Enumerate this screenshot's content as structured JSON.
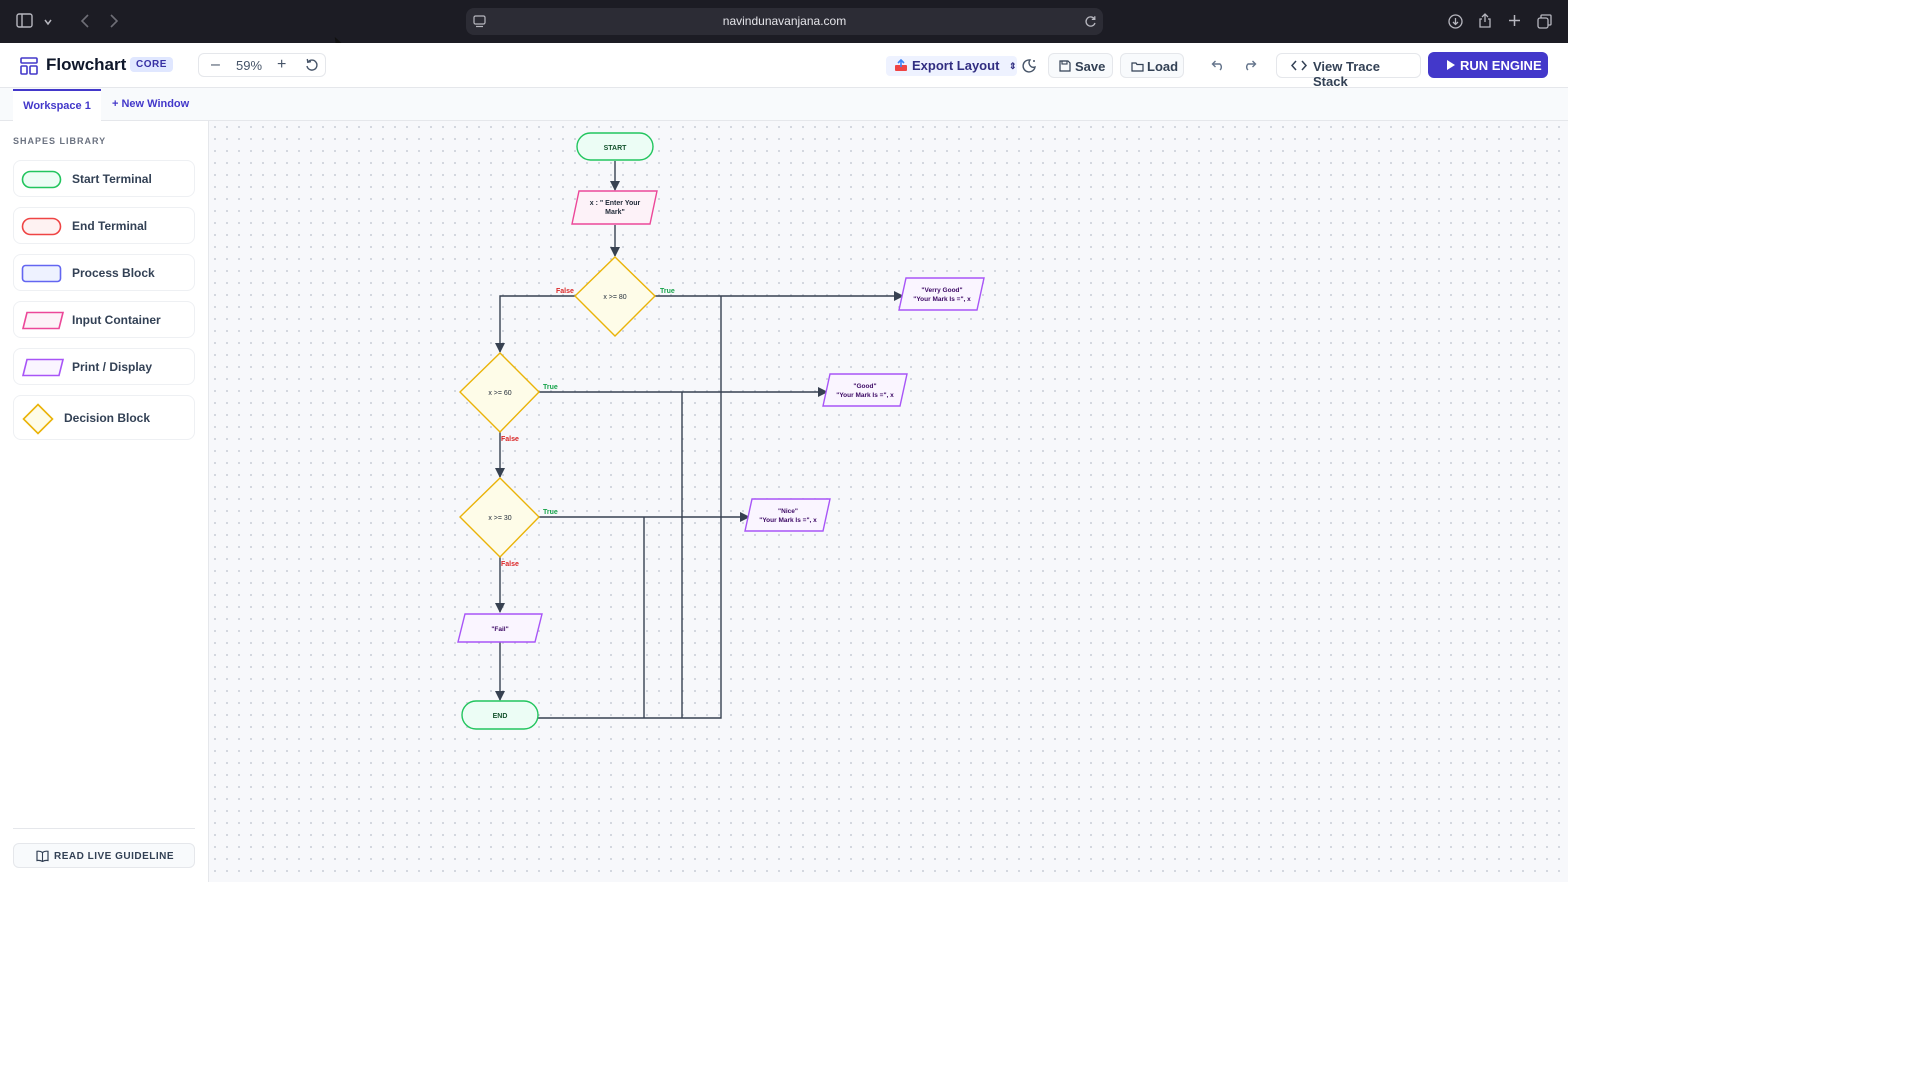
{
  "browser": {
    "url": "navindunavanjana.com"
  },
  "app": {
    "title": "Flowchart",
    "badge": "CORE"
  },
  "toolbar": {
    "zoom": "59%",
    "export_label": "Export Layout",
    "save_label": "Save",
    "load_label": "Load",
    "trace_label": "View Trace Stack",
    "run_label": "RUN ENGINE"
  },
  "tabs": {
    "active": "Workspace 1",
    "new_window": "+ New Window"
  },
  "sidebar": {
    "title": "SHAPES LIBRARY",
    "items": [
      {
        "label": "Start Terminal",
        "color": "#22c55e"
      },
      {
        "label": "End Terminal",
        "color": "#ef4444"
      },
      {
        "label": "Process Block",
        "color": "#6366f1"
      },
      {
        "label": "Input Container",
        "color": "#ec4899"
      },
      {
        "label": "Print / Display",
        "color": "#a855f7"
      },
      {
        "label": "Decision Block",
        "color": "#eab308"
      }
    ],
    "guideline_label": "READ LIVE GUIDELINE"
  },
  "flowchart": {
    "start": "START",
    "input_line1": "x : \" Enter Your",
    "input_line2": "Mark\"",
    "decision1": "x >= 80",
    "decision2": "x >= 60",
    "decision3": "x >= 30",
    "out1_line1": "\"Verry Good\"",
    "out1_line2": "\"Your Mark Is =\", x",
    "out2_line1": "\"Good\"",
    "out2_line2": "\"Your Mark Is =\", x",
    "out3_line1": "\"Nice\"",
    "out3_line2": "\"Your Mark Is =\", x",
    "fail": "\"Fail\"",
    "end": "END",
    "true_label": "True",
    "false_label": "False"
  },
  "colors": {
    "accent": "#4338ca",
    "start_green": "#22c55e",
    "decision_gold": "#eab308",
    "print_purple": "#a855f7",
    "input_pink": "#ec4899",
    "true_green": "#16a34a",
    "false_red": "#dc2626"
  }
}
